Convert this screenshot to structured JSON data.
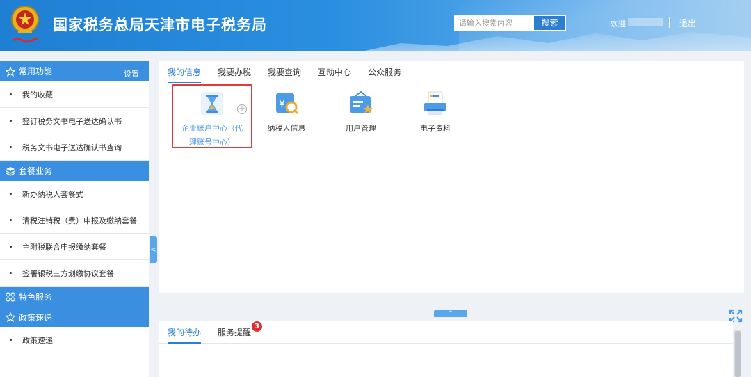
{
  "header": {
    "title": "国家税务总局天津市电子税务局",
    "search_placeholder": "请输入搜索内容",
    "search_label": "搜索",
    "welcome": "欢迎",
    "logout": "退出",
    "emblem_icon": "national-tax-emblem-icon",
    "colors": {
      "bar": "#2b8fe0",
      "accent": "#2c7ed1"
    }
  },
  "sidebar": {
    "sections": [
      {
        "title": "常用功能",
        "icon": "star-icon",
        "action": "设置",
        "items": [
          "我的收藏",
          "签订税务文书电子送达确认书",
          "税务文书电子送达确认书查询"
        ]
      },
      {
        "title": "套餐业务",
        "icon": "layers-icon",
        "items": [
          "新办纳税人套餐式",
          "清税注销税（费）申报及缴纳套餐",
          "主附税联合申报缴纳套餐",
          "签署银税三方划缴协议套餐"
        ]
      },
      {
        "title": "特色服务",
        "icon": "grid-icon",
        "items": []
      },
      {
        "title": "政策速递",
        "icon": "star-icon",
        "items": [
          "政策速递"
        ]
      }
    ],
    "collapse_label": "<"
  },
  "main": {
    "tabs": [
      {
        "label": "我的信息",
        "active": true
      },
      {
        "label": "我要办税",
        "active": false
      },
      {
        "label": "我要查询",
        "active": false
      },
      {
        "label": "互动中心",
        "active": false
      },
      {
        "label": "公众服务",
        "active": false
      }
    ],
    "tiles": [
      {
        "label": "企业账户中心（代理账号中心）",
        "icon": "hourglass-icon",
        "highlighted": true
      },
      {
        "label": "纳税人信息",
        "icon": "yuan-search-icon",
        "highlighted": false
      },
      {
        "label": "用户管理",
        "icon": "user-card-star-icon",
        "highlighted": false
      },
      {
        "label": "电子资料",
        "icon": "document-printer-icon",
        "highlighted": false
      }
    ],
    "plus_label": "+"
  },
  "bottom": {
    "tabs": [
      {
        "label": "我的待办",
        "active": true
      },
      {
        "label": "服务提醒",
        "active": false,
        "badge": "3"
      }
    ],
    "expand_label": "^"
  }
}
